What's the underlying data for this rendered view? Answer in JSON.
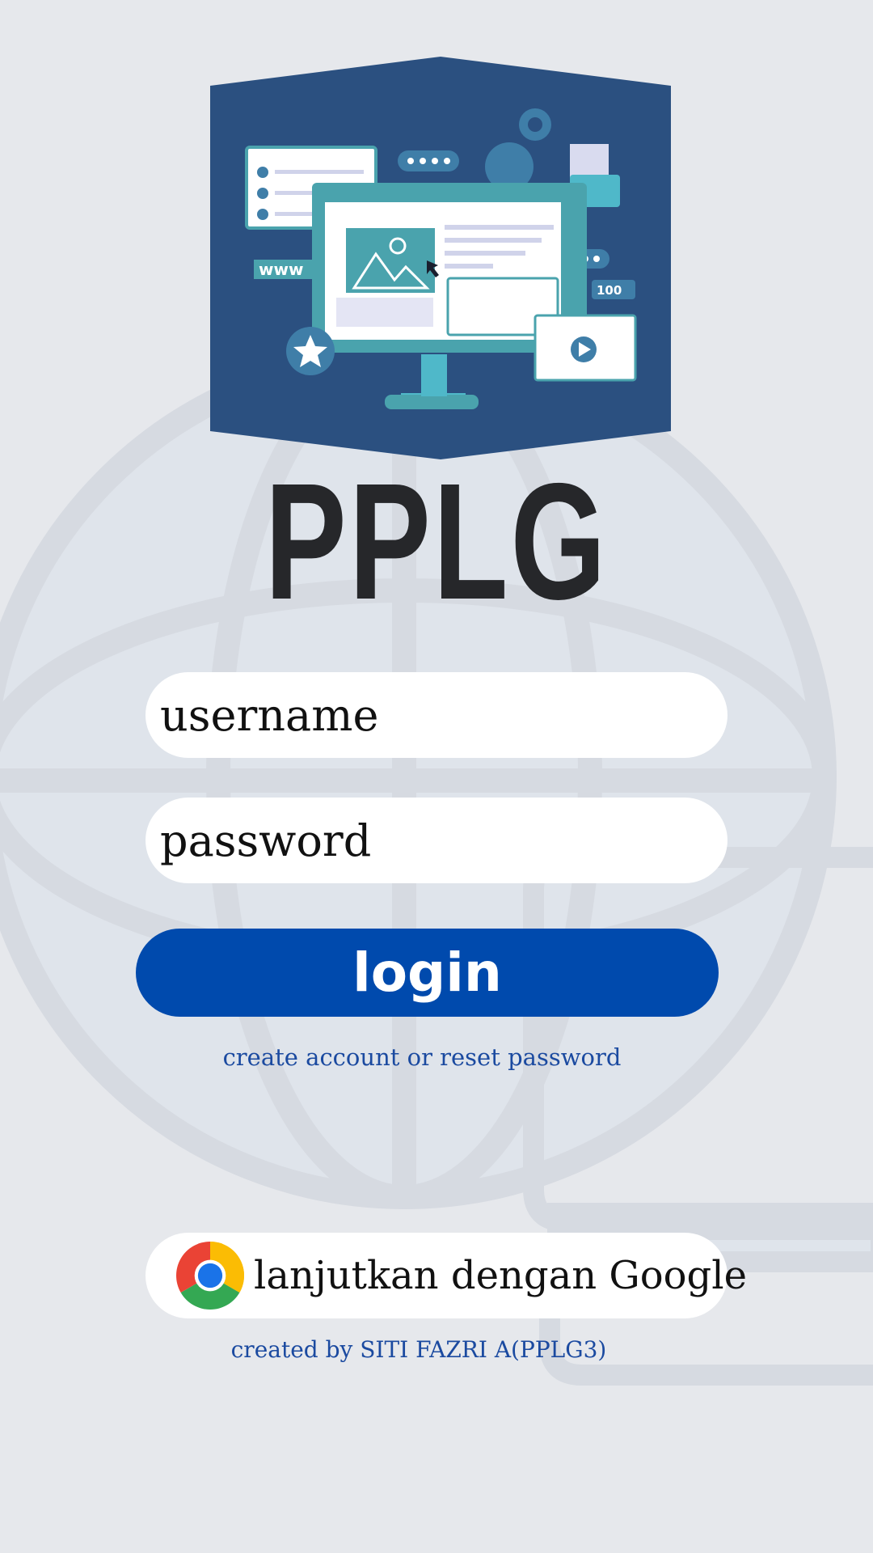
{
  "app": {
    "title": "PPLG"
  },
  "form": {
    "username_placeholder": "username",
    "password_placeholder": "password",
    "login_label": "login",
    "secondary_link": "create account or reset password"
  },
  "google": {
    "label": "lanjutkan dengan Google",
    "icon": "chrome-icon"
  },
  "footer": {
    "credit": "created by SITI FAZRI A(PPLG3)"
  },
  "hero": {
    "url_label": "www",
    "likes_label": "100"
  },
  "colors": {
    "background": "#e6e8ec",
    "hero_bg": "#2b5080",
    "accent": "#004aad",
    "teal": "#4aa3ad",
    "title": "#26272a",
    "link": "#1b4aa0"
  }
}
